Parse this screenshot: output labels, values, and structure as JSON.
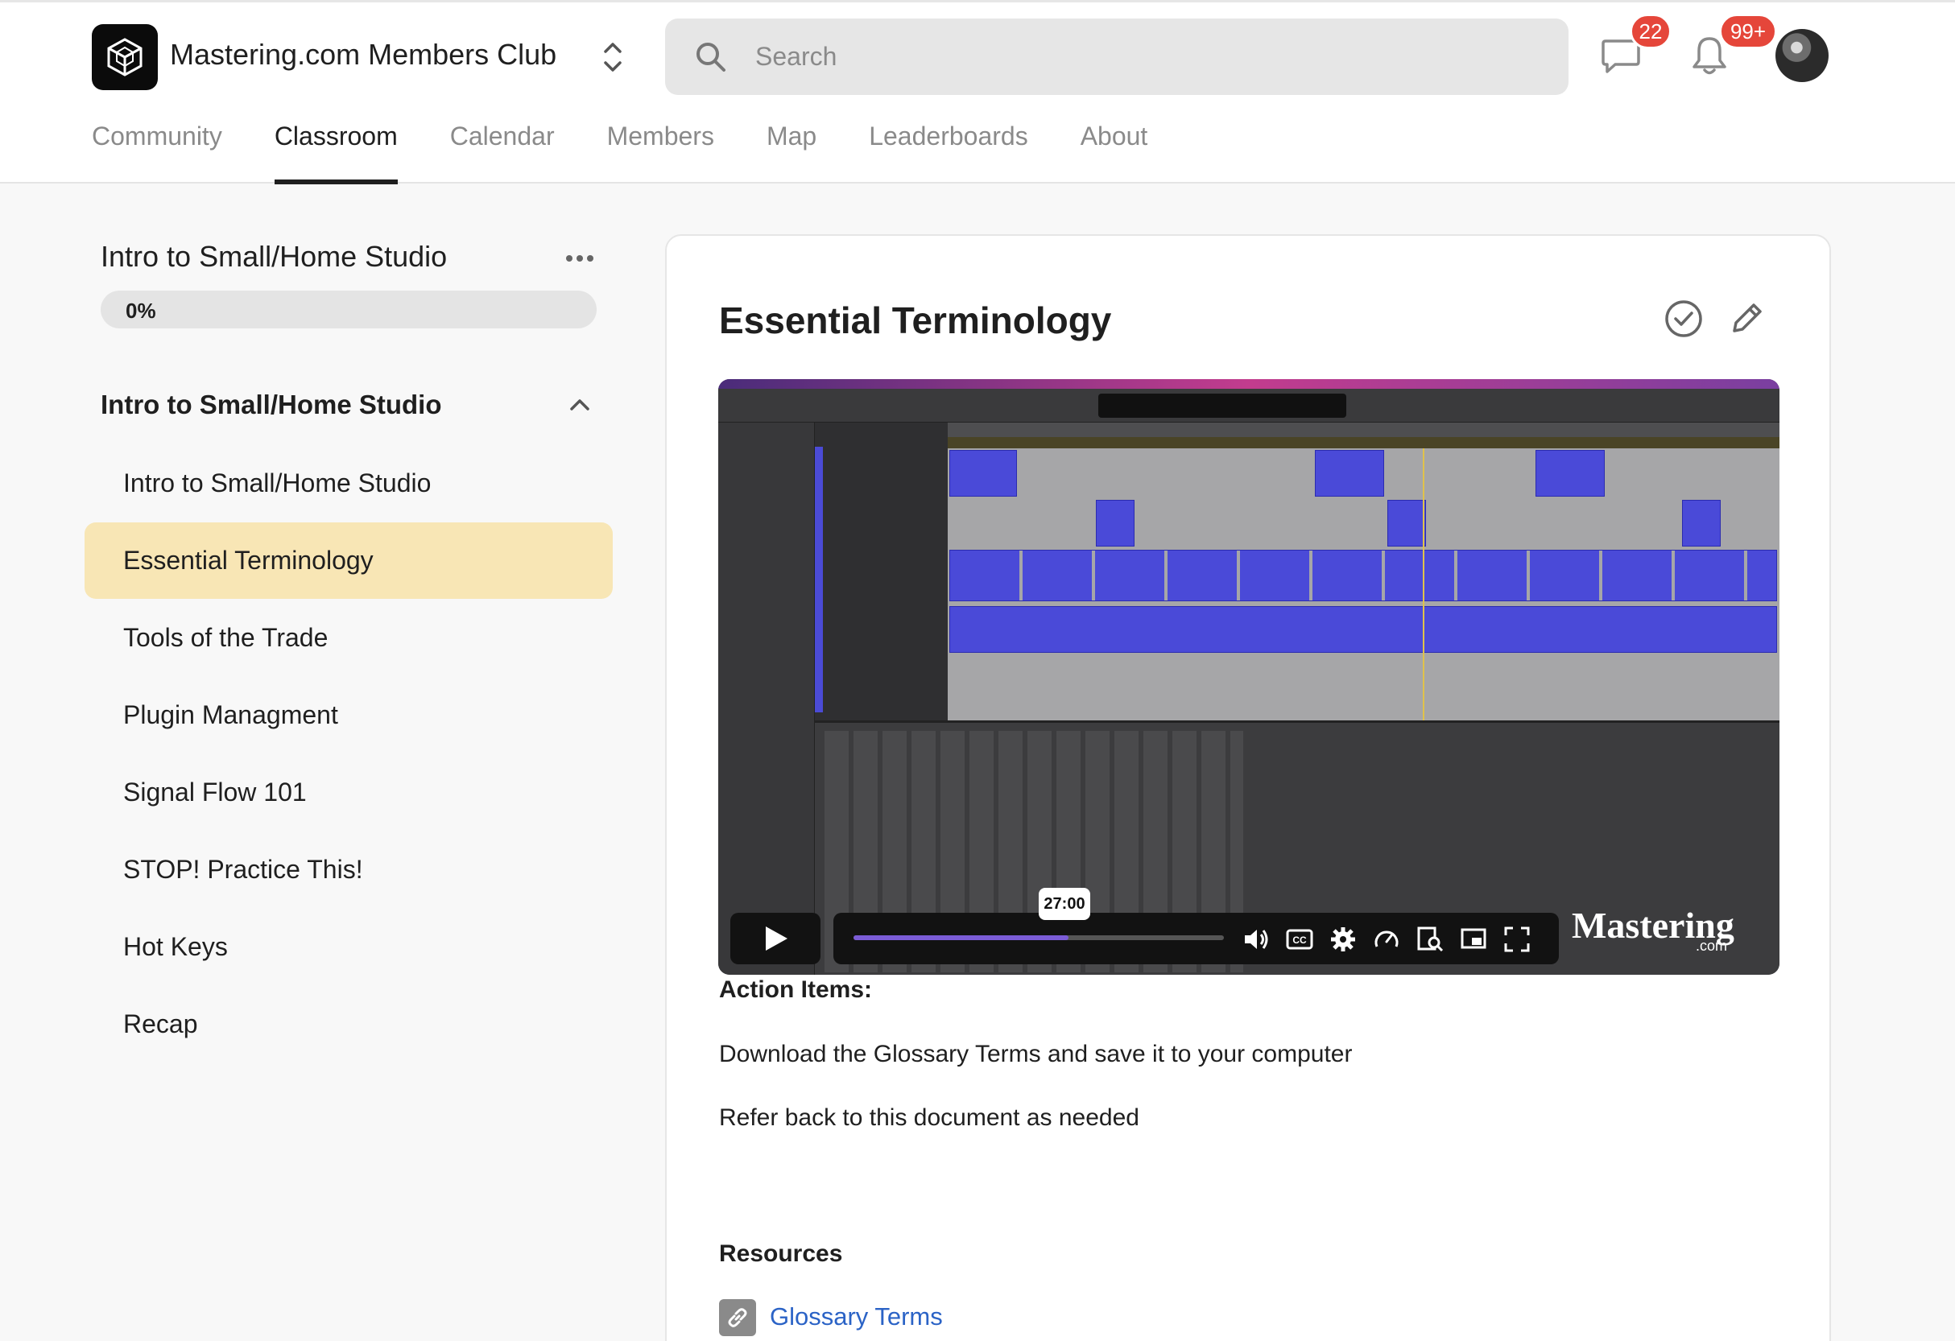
{
  "header": {
    "group_name": "Mastering.com Members Club",
    "search_placeholder": "Search",
    "chat_badge": "22",
    "notifications_badge": "99+"
  },
  "nav": {
    "tabs": [
      {
        "label": "Community",
        "active": false
      },
      {
        "label": "Classroom",
        "active": true
      },
      {
        "label": "Calendar",
        "active": false
      },
      {
        "label": "Members",
        "active": false
      },
      {
        "label": "Map",
        "active": false
      },
      {
        "label": "Leaderboards",
        "active": false
      },
      {
        "label": "About",
        "active": false
      }
    ]
  },
  "sidebar": {
    "course_title": "Intro to Small/Home Studio",
    "progress_label": "0%",
    "progress_value": 0,
    "section_title": "Intro to Small/Home Studio",
    "lessons": [
      {
        "label": "Intro to Small/Home Studio",
        "active": false
      },
      {
        "label": "Essential Terminology",
        "active": true
      },
      {
        "label": "Tools of the Trade",
        "active": false
      },
      {
        "label": "Plugin Managment",
        "active": false
      },
      {
        "label": "Signal Flow 101",
        "active": false
      },
      {
        "label": "STOP! Practice This!",
        "active": false
      },
      {
        "label": "Hot Keys",
        "active": false
      },
      {
        "label": "Recap",
        "active": false
      }
    ]
  },
  "lesson": {
    "title": "Essential Terminology",
    "video": {
      "hover_time": "27:00",
      "played_fraction": 0.58,
      "watermark": "Mastering",
      "watermark_sub": ".com"
    },
    "action_heading": "Action Items:",
    "action_items": [
      "Download the Glossary Terms and save it to your computer",
      "Refer back to this document as needed"
    ],
    "resources_heading": "Resources",
    "resources": [
      {
        "label": "Glossary Terms"
      }
    ]
  },
  "colors": {
    "accent_active_lesson": "#f8e6b5",
    "badge": "#e5463a",
    "link": "#2b63c6",
    "seek_played": "#7b5cd6"
  }
}
